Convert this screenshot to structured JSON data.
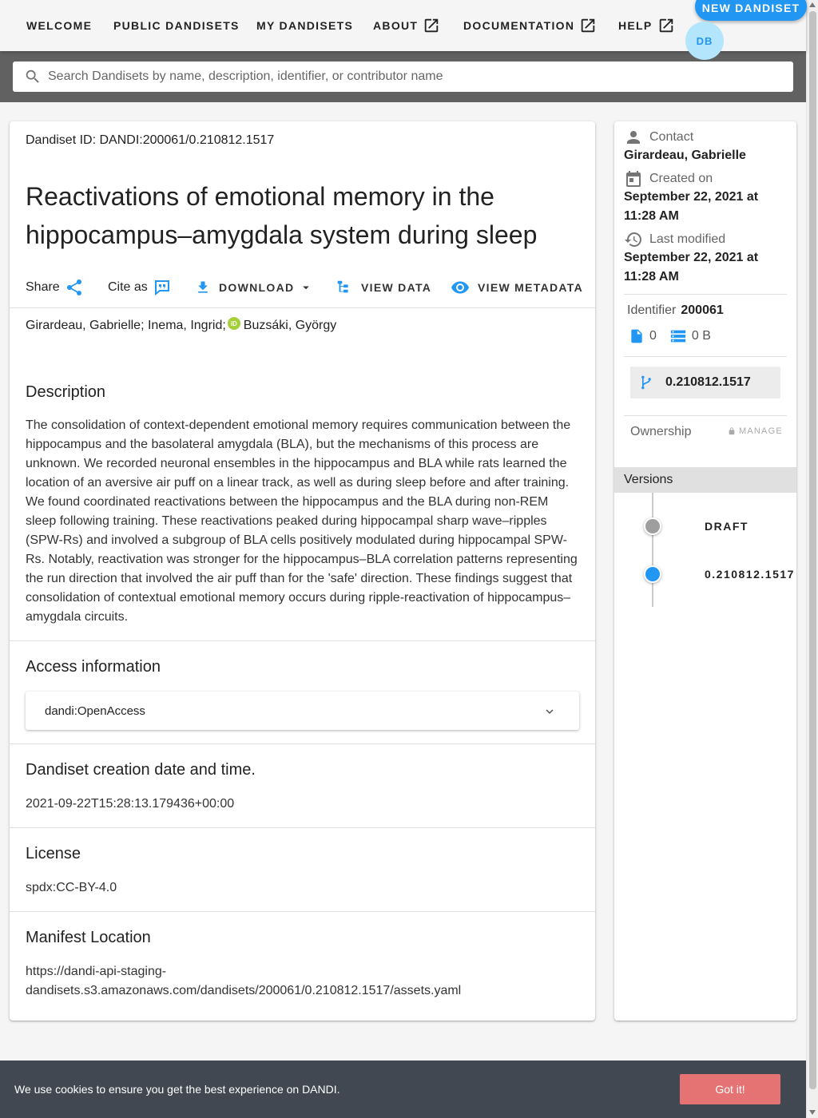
{
  "nav": {
    "items": [
      {
        "label": "WELCOME",
        "external": false
      },
      {
        "label": "PUBLIC DANDISETS",
        "external": false
      },
      {
        "label": "MY DANDISETS",
        "external": false
      },
      {
        "label": "ABOUT",
        "external": true
      },
      {
        "label": "DOCUMENTATION",
        "external": true
      },
      {
        "label": "HELP",
        "external": true
      }
    ],
    "new_button": "NEW DANDISET",
    "avatar": "DB",
    "accent": "#2196f3"
  },
  "search": {
    "placeholder": "Search Dandisets by name, description, identifier, or contributor name"
  },
  "dandiset": {
    "id_line": "Dandiset ID: DANDI:200061/0.210812.1517",
    "title": "Reactivations of emotional memory in the hippocampus–amygdala system during sleep",
    "actions": {
      "share": "Share",
      "cite": "Cite as",
      "download": "DOWNLOAD",
      "view_data": "VIEW DATA",
      "view_metadata": "VIEW METADATA"
    },
    "authors": {
      "first": "Girardeau, Gabrielle; Inema, Ingrid;",
      "second": "Buzsáki, György"
    },
    "description_heading": "Description",
    "description": "The consolidation of context-dependent emotional memory requires communication between the hippocampus and the basolateral amygdala (BLA), but the mechanisms of this process are unknown. We recorded neuronal ensembles in the hippocampus and BLA while rats learned the location of an aversive air puff on a linear track, as well as during sleep before and after training. We found coordinated reactivations between the hippocampus and the BLA during non-REM sleep following training. These reactivations peaked during hippocampal sharp wave–ripples (SPW-Rs) and involved a subgroup of BLA cells positively modulated during hippocampal SPW-Rs. Notably, reactivation was stronger for the hippocampus–BLA correlation patterns representing the run direction that involved the air puff than for the 'safe' direction. These findings suggest that consolidation of contextual emotional memory occurs during ripple-reactivation of hippocampus–amygdala circuits.",
    "access_heading": "Access information",
    "access_value": "dandi:OpenAccess",
    "creation_heading": "Dandiset creation date and time.",
    "creation_value": "2021-09-22T15:28:13.179436+00:00",
    "license_heading": "License",
    "license_value": "spdx:CC-BY-4.0",
    "manifest_heading": "Manifest Location",
    "manifest_line1": "https://dandi-api-staging-",
    "manifest_line2": "dandisets.s3.amazonaws.com/dandisets/200061/0.210812.1517/assets.yaml"
  },
  "sidebar": {
    "contact_label": "Contact",
    "contact_value": "Girardeau, Gabrielle",
    "created_label": "Created on",
    "created_value_1": "September 22, 2021 at",
    "created_value_2": "11:28 AM",
    "modified_label": "Last modified",
    "modified_value_1": "September 22, 2021 at",
    "modified_value_2": "11:28 AM",
    "identifier_label": "Identifier",
    "identifier_value": "200061",
    "file_count": "0",
    "size": "0 B",
    "version": "0.210812.1517",
    "ownership_label": "Ownership",
    "manage_label": "MANAGE",
    "versions_heading": "Versions",
    "versions": [
      {
        "label": "DRAFT",
        "color": "#9e9e9e"
      },
      {
        "label": "0.210812.1517",
        "color": "#2196f3"
      }
    ]
  },
  "cookie": {
    "text": "We use cookies to ensure you get the best experience on DANDI.",
    "button": "Got it!"
  }
}
